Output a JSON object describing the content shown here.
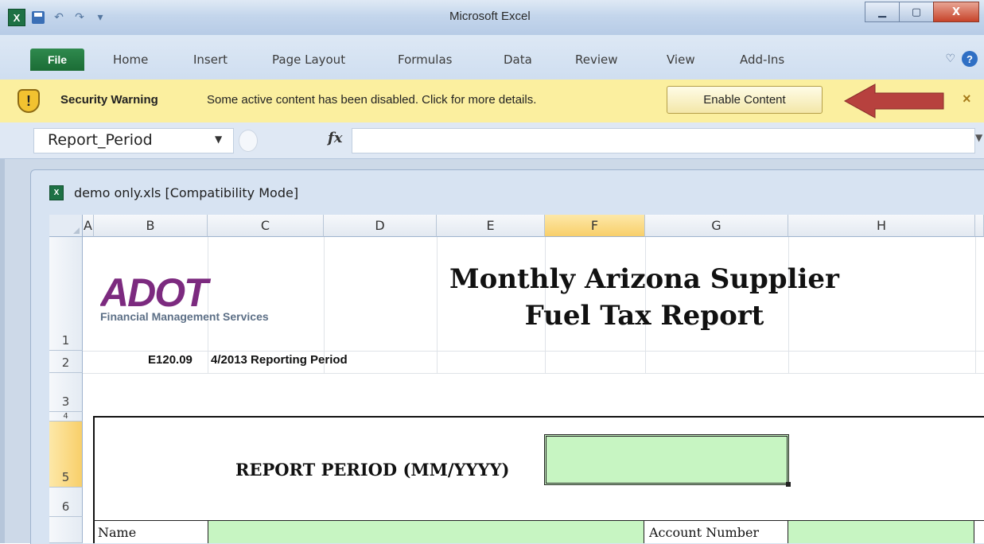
{
  "window": {
    "title": "Microsoft Excel",
    "controls": {
      "minimize": "▁",
      "maximize": "▢",
      "close": "X"
    }
  },
  "qat": {
    "app_icon_letter": "X",
    "undo": "↶",
    "redo": "↷",
    "customize": "▾"
  },
  "ribbon": {
    "file_tab": "File",
    "tabs": [
      "Home",
      "Insert",
      "Page Layout",
      "Formulas",
      "Data",
      "Review",
      "View",
      "Add-Ins"
    ],
    "help": "?",
    "minimize_ribbon": "♡"
  },
  "security_bar": {
    "title": "Security Warning",
    "message": "Some active content has been disabled. Click for more details.",
    "button": "Enable Content",
    "close": "×",
    "arrow_color": "#b7413e"
  },
  "formula_bar": {
    "name_box": "Report_Period",
    "fx": "fx",
    "formula": ""
  },
  "workbook": {
    "title": "demo only.xls  [Compatibility Mode]",
    "columns": [
      "A",
      "B",
      "C",
      "D",
      "E",
      "F",
      "G",
      "H"
    ],
    "selected_column": "F",
    "rows": [
      "1",
      "2",
      "3",
      "4",
      "5",
      "6"
    ],
    "selected_row": "5"
  },
  "sheet": {
    "logo_text": "ADOT",
    "logo_subtitle": "Financial Management Services",
    "report_title_line1": "Monthly Arizona Supplier",
    "report_title_line2": "Fuel Tax Report",
    "form_code": "E120.09",
    "reporting_period": "4/2013 Reporting Period",
    "report_period_label": "REPORT PERIOD (MM/YYYY)",
    "name_label": "Name",
    "account_label": "Account Number",
    "input_fill": "#c7f5c2"
  }
}
